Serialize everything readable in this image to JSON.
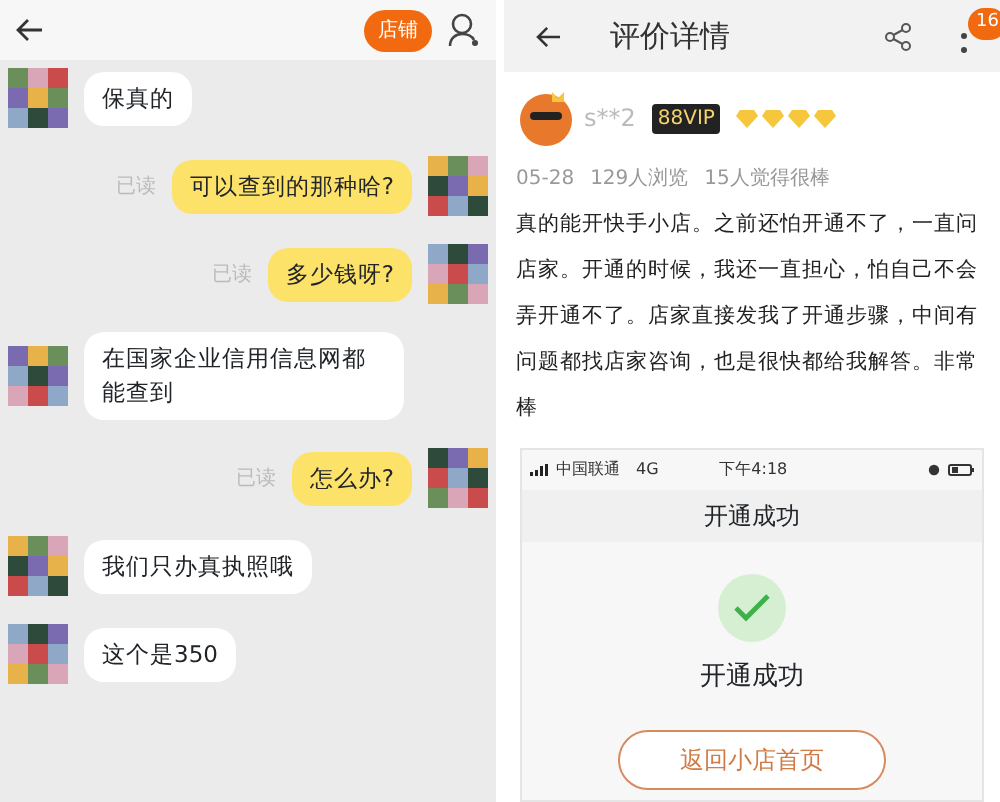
{
  "chat": {
    "shop_button": "店铺",
    "messages": [
      {
        "kind": "received",
        "text": "保真的"
      },
      {
        "kind": "sent",
        "text": "可以查到的那种哈?",
        "status": "已读"
      },
      {
        "kind": "sent",
        "text": "多少钱呀?",
        "status": "已读"
      },
      {
        "kind": "received",
        "text": "在国家企业信用信息网都能查到"
      },
      {
        "kind": "sent",
        "text": "怎么办?",
        "status": "已读"
      },
      {
        "kind": "received",
        "text": "我们只办真执照哦"
      },
      {
        "kind": "received",
        "text": "这个是350"
      }
    ]
  },
  "review": {
    "title": "评价详情",
    "badge": "16",
    "user": "s**2",
    "vip": "88VIP",
    "stars": 4,
    "meta": [
      "05-28",
      "129人浏览",
      "15人觉得很棒"
    ],
    "body": "真的能开快手小店。之前还怕开通不了，一直问店家。开通的时候，我还一直担心，怕自己不会弄开通不了。店家直接发我了开通步骤，中间有问题都找店家咨询，也是很快都给我解答。非常棒",
    "screenshot": {
      "carrier": "中国联通",
      "network": "4G",
      "time": "下午4:18",
      "title": "开通成功",
      "message": "开通成功",
      "button": "返回小店首页"
    }
  }
}
